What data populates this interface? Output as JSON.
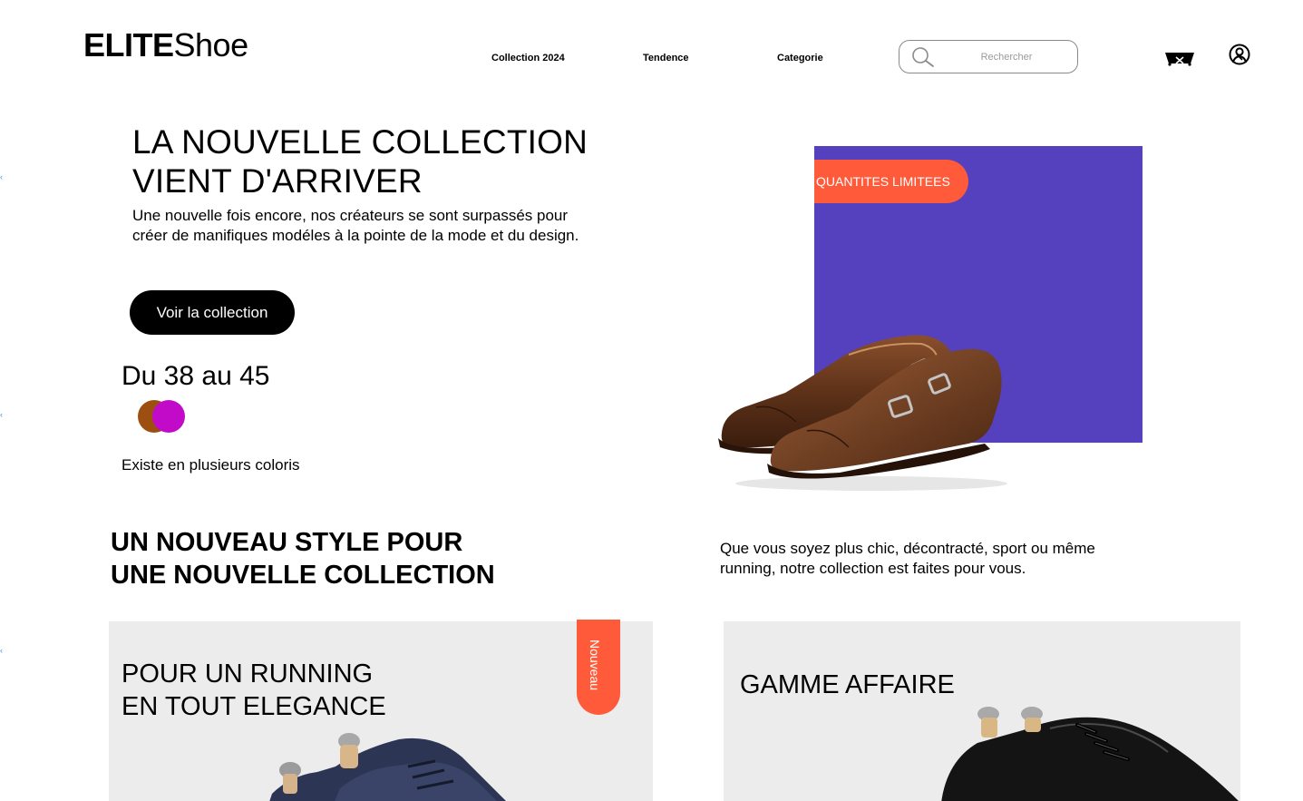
{
  "brand": {
    "bold": "ELITE",
    "light": "Shoe"
  },
  "nav": {
    "items": [
      "Collection 2024",
      "Tendence",
      "Categorie"
    ]
  },
  "search": {
    "placeholder": "Rechercher"
  },
  "hero": {
    "title_line1": "LA NOUVELLE COLLECTION",
    "title_line2": "VIENT D'ARRIVER",
    "description": "Une nouvelle fois encore, nos créateurs se sont surpassés pour créer de manifiques modéles à la pointe de la mode et du design.",
    "cta_label": "Voir la collection",
    "sizes": "Du 38 au 45",
    "colors_note": "Existe en plusieurs coloris",
    "swatches": [
      "#9c4f10",
      "#c10bc9"
    ],
    "badge": "QUANTITES LIMITEES",
    "panel_color": "#5540bd",
    "accent_color": "#ff5b3a"
  },
  "section": {
    "title_line1": "UN NOUVEAU STYLE POUR",
    "title_line2": "UNE NOUVELLE COLLECTION",
    "description": "Que vous soyez plus chic, décontracté, sport ou même running, notre collection est faites pour vous."
  },
  "cards": [
    {
      "title_line1": "POUR UN RUNNING",
      "title_line2": "EN TOUT ELEGANCE",
      "badge": "Nouveau"
    },
    {
      "title_line1": "GAMME AFFAIRE"
    }
  ],
  "icons": {
    "search": "search-icon",
    "cart": "cart-icon",
    "user": "user-icon"
  }
}
